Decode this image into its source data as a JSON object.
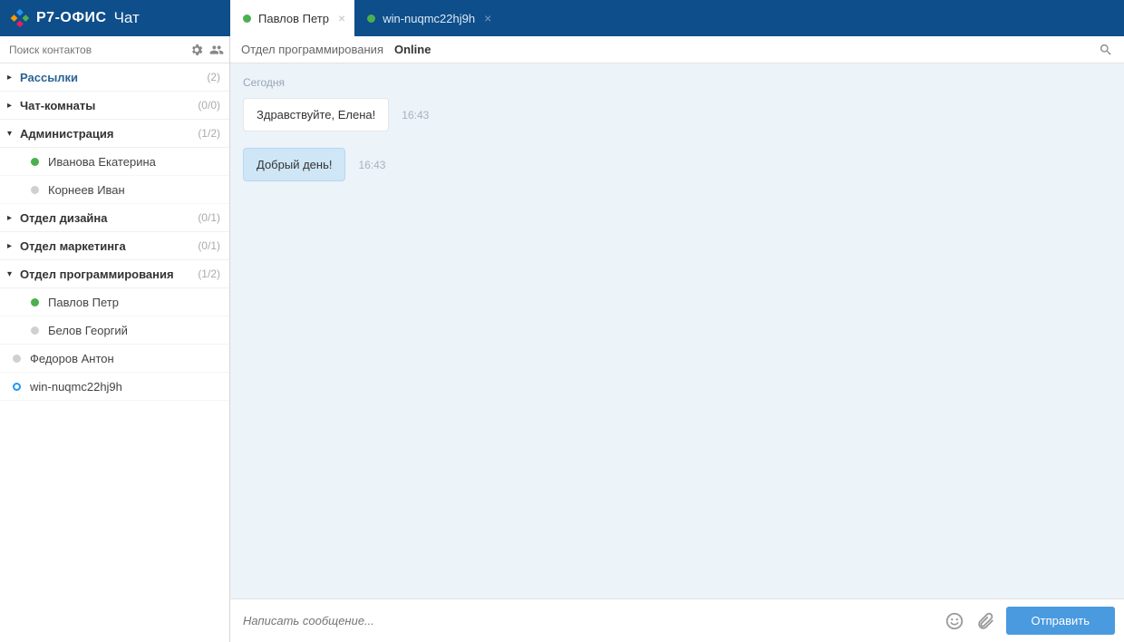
{
  "header": {
    "brand": "Р7-ОФИС",
    "title": "Чат"
  },
  "tabs": [
    {
      "label": "Павлов Петр",
      "active": true
    },
    {
      "label": "win-nuqmc22hj9h",
      "active": false
    }
  ],
  "sidebar": {
    "search_placeholder": "Поиск контактов",
    "groups": [
      {
        "name": "Рассылки",
        "count": "(2)",
        "expanded": false,
        "link": true,
        "items": []
      },
      {
        "name": "Чат-комнаты",
        "count": "(0/0)",
        "expanded": false,
        "items": []
      },
      {
        "name": "Администрация",
        "count": "(1/2)",
        "expanded": true,
        "items": [
          {
            "name": "Иванова Екатерина",
            "status": "online"
          },
          {
            "name": "Корнеев Иван",
            "status": "offline"
          }
        ]
      },
      {
        "name": "Отдел дизайна",
        "count": "(0/1)",
        "expanded": false,
        "items": []
      },
      {
        "name": "Отдел маркетинга",
        "count": "(0/1)",
        "expanded": false,
        "items": []
      },
      {
        "name": "Отдел программирования",
        "count": "(1/2)",
        "expanded": true,
        "items": [
          {
            "name": "Павлов Петр",
            "status": "online"
          },
          {
            "name": "Белов Георгий",
            "status": "offline"
          }
        ]
      }
    ],
    "root_contacts": [
      {
        "name": "Федоров Антон",
        "status": "offline"
      },
      {
        "name": "win-nuqmc22hj9h",
        "status": "self"
      }
    ]
  },
  "chat": {
    "department": "Отдел программирования",
    "status": "Online",
    "date_label": "Сегодня",
    "messages": [
      {
        "text": "Здравствуйте, Елена!",
        "time": "16:43",
        "mine": false
      },
      {
        "text": "Добрый день!",
        "time": "16:43",
        "mine": true
      }
    ],
    "composer_placeholder": "Написать сообщение...",
    "send_label": "Отправить"
  }
}
